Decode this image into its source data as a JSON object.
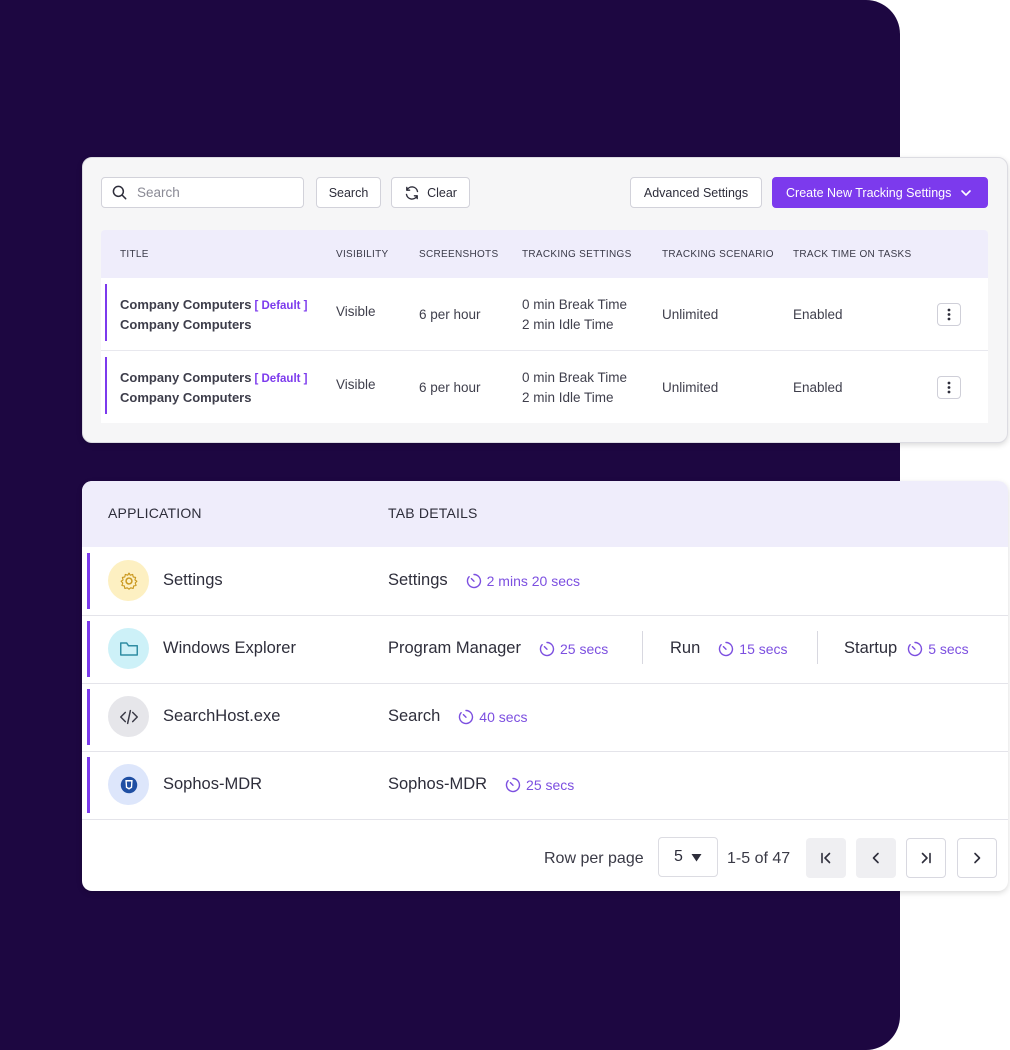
{
  "tracking": {
    "search_placeholder": "Search",
    "search_button": "Search",
    "clear_button": "Clear",
    "advanced_button": "Advanced Settings",
    "create_button": "Create New Tracking Settings",
    "columns": [
      "TITLE",
      "VISIBILITY",
      "SCREENSHOTS",
      "TRACKING SETTINGS",
      "TRACKING SCENARIO",
      "TRACK TIME ON TASKS"
    ],
    "rows": [
      {
        "title": "Company Computers",
        "tag": "[ Default ]",
        "subtitle": "Company Computers",
        "visibility": "Visible",
        "screenshots": "6 per hour",
        "break_time": "0 min Break Time",
        "idle_time": "2 min Idle Time",
        "scenario": "Unlimited",
        "track_tasks": "Enabled"
      },
      {
        "title": "Company Computers",
        "tag": "[ Default ]",
        "subtitle": "Company Computers",
        "visibility": "Visible",
        "screenshots": "6 per hour",
        "break_time": "0 min Break Time",
        "idle_time": "2 min Idle Time",
        "scenario": "Unlimited",
        "track_tasks": "Enabled"
      }
    ]
  },
  "applications": {
    "columns": [
      "APPLICATION",
      "TAB DETAILS"
    ],
    "rows": [
      {
        "icon": "gear-icon",
        "name": "Settings",
        "tabs": [
          {
            "name": "Settings",
            "time": "2 mins 20 secs"
          }
        ]
      },
      {
        "icon": "folder-icon",
        "name": "Windows Explorer",
        "tabs": [
          {
            "name": "Program Manager",
            "time": "25 secs"
          },
          {
            "name": "Run",
            "time": "15 secs"
          },
          {
            "name": "Startup",
            "time": "5 secs"
          }
        ]
      },
      {
        "icon": "code-icon",
        "name": "SearchHost.exe",
        "tabs": [
          {
            "name": "Search",
            "time": "40 secs"
          }
        ]
      },
      {
        "icon": "shield-icon",
        "name": "Sophos-MDR",
        "tabs": [
          {
            "name": "Sophos-MDR",
            "time": "25 secs"
          }
        ]
      }
    ],
    "pagination": {
      "rows_per_page_label": "Row per page",
      "rows_per_page": "5",
      "range": "1-5 of 47"
    }
  },
  "colors": {
    "accent": "#7c3aed",
    "background": "#1d0741",
    "header_tint": "#efedfb"
  }
}
